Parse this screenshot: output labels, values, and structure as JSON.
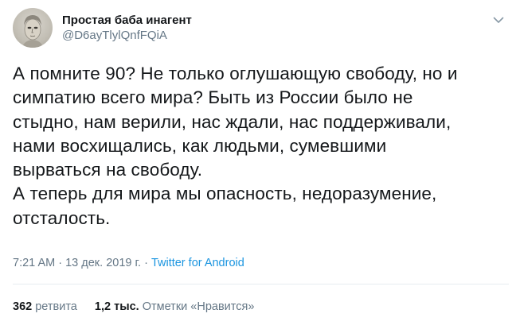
{
  "author": {
    "display_name": "Простая баба инагент",
    "handle": "@D6ayTlylQnfFQiA",
    "avatar_icon": "avatar-portrait"
  },
  "tweet": {
    "lines": [
      "А помните 90? Не только оглушающую свободу, но и",
      "симпатию всего мира? Быть из России было не",
      "стыдно, нам верили, нас ждали, нас поддерживали,",
      "нами восхищались, как людьми, сумевшими",
      "вырваться на свободу.",
      "А теперь для мира мы опасность, недоразумение,",
      "отсталость."
    ]
  },
  "meta": {
    "time": "7:21 AM",
    "separator": "·",
    "date": "13 дек. 2019 г.",
    "source": "Twitter for Android"
  },
  "stats": {
    "retweets_count": "362",
    "retweets_label": "ретвита",
    "likes_count": "1,2 тыс.",
    "likes_label": "Отметки «Нравится»"
  },
  "colors": {
    "text": "#14171a",
    "secondary": "#657786",
    "link": "#1b95e0",
    "divider": "#e6ecf0"
  }
}
